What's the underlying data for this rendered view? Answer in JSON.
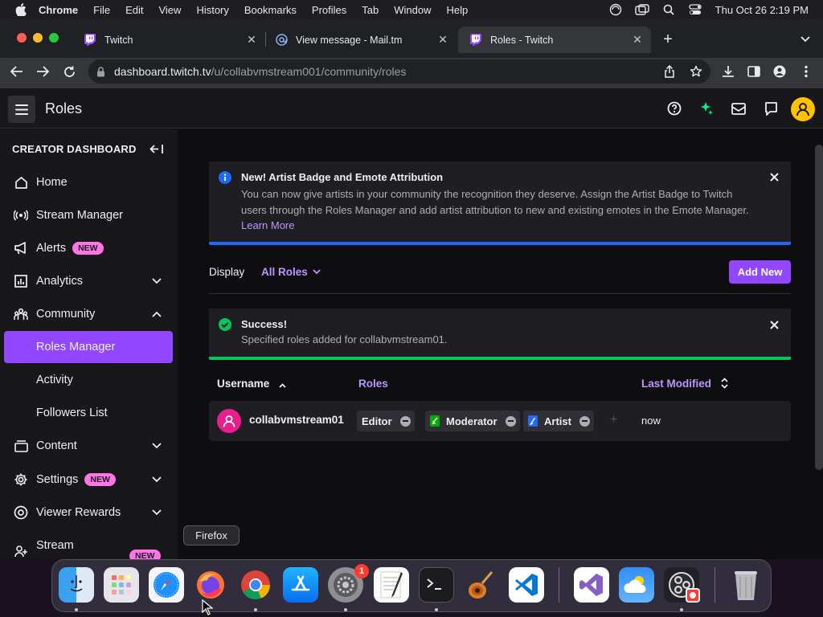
{
  "menubar": {
    "app_name": "Chrome",
    "items": [
      "File",
      "Edit",
      "View",
      "History",
      "Bookmarks",
      "Profiles",
      "Tab",
      "Window",
      "Help"
    ],
    "clock": "Thu Oct 26  2:19 PM"
  },
  "browser": {
    "tabs": [
      {
        "title": "Twitch",
        "icon": "twitch-icon"
      },
      {
        "title": "View message - Mail.tm",
        "icon": "mail-at-icon"
      },
      {
        "title": "Roles - Twitch",
        "icon": "twitch-icon",
        "active": true
      }
    ],
    "url": {
      "host": "dashboard.twitch.tv",
      "path": "/u/collabvmstream001/community/roles"
    }
  },
  "twitch": {
    "page_title": "Roles",
    "sidebar": {
      "heading": "CREATOR DASHBOARD",
      "items": [
        {
          "label": "Home",
          "icon": "home-icon"
        },
        {
          "label": "Stream Manager",
          "icon": "broadcast-icon"
        },
        {
          "label": "Alerts",
          "icon": "megaphone-icon",
          "badge": "NEW"
        },
        {
          "label": "Analytics",
          "icon": "bar-chart-icon",
          "expand": "down"
        },
        {
          "label": "Community",
          "icon": "community-icon",
          "expand": "up"
        },
        {
          "label": "Roles Manager",
          "sub": true,
          "active": true
        },
        {
          "label": "Activity",
          "sub": true
        },
        {
          "label": "Followers List",
          "sub": true
        },
        {
          "label": "Content",
          "icon": "content-icon",
          "expand": "down"
        },
        {
          "label": "Settings",
          "icon": "gear-icon",
          "badge": "NEW",
          "expand": "down"
        },
        {
          "label": "Viewer Rewards",
          "icon": "rewards-icon",
          "expand": "down"
        },
        {
          "label": "Stream",
          "icon": "stream-together-icon",
          "badge": "NEW"
        }
      ]
    },
    "banner": {
      "title": "New! Artist Badge and Emote Attribution",
      "body": "You can now give artists in your community the recognition they deserve. Assign the Artist Badge to Twitch users through the Roles Manager and add artist attribution to new and existing emotes in the Emote Manager.",
      "link": "Learn More"
    },
    "display": {
      "label": "Display",
      "selected": "All Roles"
    },
    "add_new": "Add New",
    "success": {
      "title": "Success!",
      "body": "Specified roles added for collabvmstream01."
    },
    "table": {
      "headers": {
        "username": "Username",
        "roles": "Roles",
        "last_modified": "Last Modified"
      },
      "rows": [
        {
          "username": "collabvmstream01",
          "roles": [
            {
              "label": "Editor",
              "badge": null
            },
            {
              "label": "Moderator",
              "badge": "sword-badge",
              "color": "#00ad03"
            },
            {
              "label": "Artist",
              "badge": "brush-badge",
              "color": "#1f69ff"
            }
          ],
          "modified": "now"
        }
      ]
    }
  },
  "tooltip": "Firefox",
  "dock": {
    "apps": [
      "Finder",
      "Launchpad",
      "Safari",
      "Firefox",
      "Chrome",
      "App Store",
      "System Settings",
      "TextEdit",
      "Terminal",
      "GarageBand",
      "Visual Studio Code",
      "Visual Studio",
      "Weather",
      "OBS",
      "Trash"
    ],
    "notification_badge": "1"
  },
  "colors": {
    "accent": "#9147ff",
    "link": "#bf94ff",
    "info": "#1f69ff",
    "success": "#00c85a",
    "badge_new": "#ff75e6"
  }
}
